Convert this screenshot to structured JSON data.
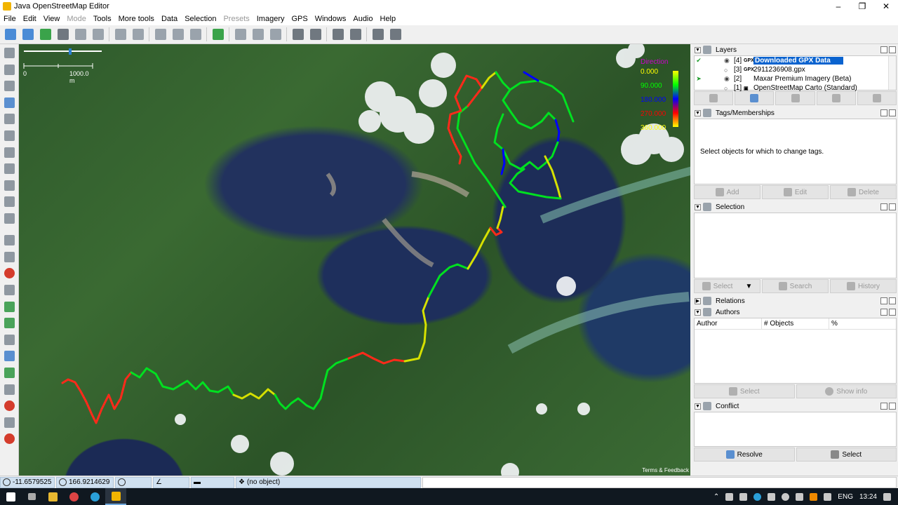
{
  "window": {
    "title": "Java OpenStreetMap Editor"
  },
  "menubar": [
    {
      "label": "File",
      "disabled": false
    },
    {
      "label": "Edit",
      "disabled": false
    },
    {
      "label": "View",
      "disabled": false
    },
    {
      "label": "Mode",
      "disabled": true
    },
    {
      "label": "Tools",
      "disabled": false
    },
    {
      "label": "More tools",
      "disabled": false
    },
    {
      "label": "Data",
      "disabled": false
    },
    {
      "label": "Selection",
      "disabled": false
    },
    {
      "label": "Presets",
      "disabled": true
    },
    {
      "label": "Imagery",
      "disabled": false
    },
    {
      "label": "GPS",
      "disabled": false
    },
    {
      "label": "Windows",
      "disabled": false
    },
    {
      "label": "Audio",
      "disabled": false
    },
    {
      "label": "Help",
      "disabled": false
    }
  ],
  "map": {
    "scale": {
      "start": "0",
      "end": "1000.0 m"
    },
    "legend": {
      "title": "Direction",
      "entries": [
        {
          "label": "0.000",
          "color": "#ffff00"
        },
        {
          "label": "90.000",
          "color": "#00ff00"
        },
        {
          "label": "180.000",
          "color": "#0000ff"
        },
        {
          "label": "270.000",
          "color": "#ff0000"
        },
        {
          "label": "360.000",
          "color": "#ffff00"
        }
      ]
    },
    "attribution": "Terms & Feedback"
  },
  "layers": {
    "title": "Layers",
    "items": [
      {
        "num": "[4]",
        "type": "GPX",
        "name": "Downloaded GPX Data",
        "active": true,
        "visible": true
      },
      {
        "num": "[3]",
        "type": "GPX",
        "name": "2911236908.gpx",
        "active": false,
        "visible": false
      },
      {
        "num": "[2]",
        "type": "",
        "name": "Maxar Premium Imagery (Beta)",
        "active": false,
        "visible": true
      },
      {
        "num": "[1]",
        "type": "",
        "name": "OpenStreetMap Carto (Standard)",
        "active": false,
        "visible": false
      }
    ]
  },
  "tags": {
    "title": "Tags/Memberships",
    "message": "Select objects for which to change tags.",
    "add": "Add",
    "edit": "Edit",
    "delete": "Delete"
  },
  "selection": {
    "title": "Selection",
    "select": "Select",
    "search": "Search",
    "history": "History"
  },
  "relations": {
    "title": "Relations"
  },
  "authors": {
    "title": "Authors",
    "columns": [
      "Author",
      "# Objects",
      "%"
    ],
    "select": "Select",
    "show_info": "Show info"
  },
  "conflict": {
    "title": "Conflict",
    "resolve": "Resolve",
    "select": "Select"
  },
  "status": {
    "lat": "-11.6579525",
    "lon": "166.9214629",
    "object": "(no object)"
  },
  "taskbar": {
    "lang": "ENG",
    "time": "13:24"
  }
}
